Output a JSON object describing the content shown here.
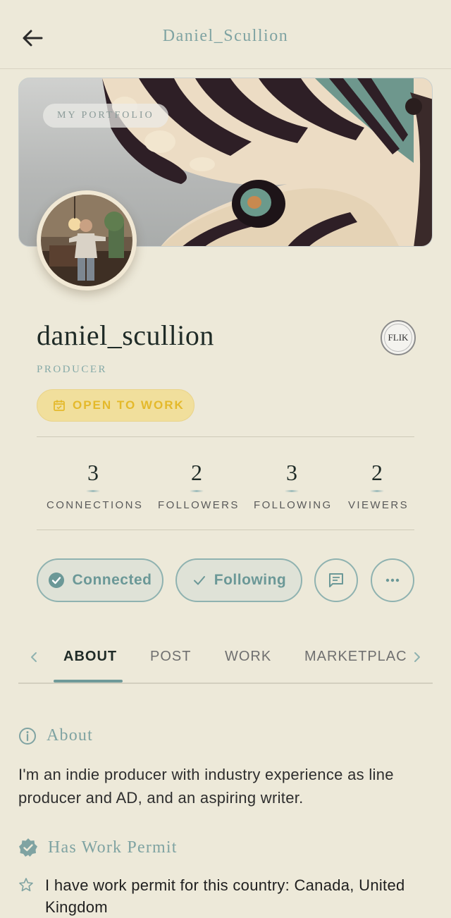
{
  "header": {
    "title": "Daniel_Scullion"
  },
  "banner": {
    "portfolio_label": "MY PORTFOLIO"
  },
  "profile": {
    "username": "daniel_scullion",
    "role": "PRODUCER",
    "open_to_work": "OPEN TO WORK",
    "badge_text": "FLIK"
  },
  "stats": [
    {
      "value": "3",
      "label": "CONNECTIONS"
    },
    {
      "value": "2",
      "label": "FOLLOWERS"
    },
    {
      "value": "3",
      "label": "FOLLOWING"
    },
    {
      "value": "2",
      "label": "VIEWERS"
    }
  ],
  "actions": {
    "connected_label": "Connected",
    "following_label": "Following"
  },
  "tabs": [
    {
      "label": "ABOUT",
      "active": true
    },
    {
      "label": "POST",
      "active": false
    },
    {
      "label": "WORK",
      "active": false
    },
    {
      "label": "MARKETPLACE",
      "active": false
    }
  ],
  "about": {
    "heading": "About",
    "text": "I'm an indie producer with industry experience as line producer and AD, and an aspiring writer."
  },
  "permit": {
    "heading": "Has Work Permit",
    "text": "I have work permit for this country: Canada, United Kingdom"
  },
  "colors": {
    "accent": "#7fa3a2",
    "background": "#ede9d9",
    "open_to_work": "#e4b92b"
  }
}
